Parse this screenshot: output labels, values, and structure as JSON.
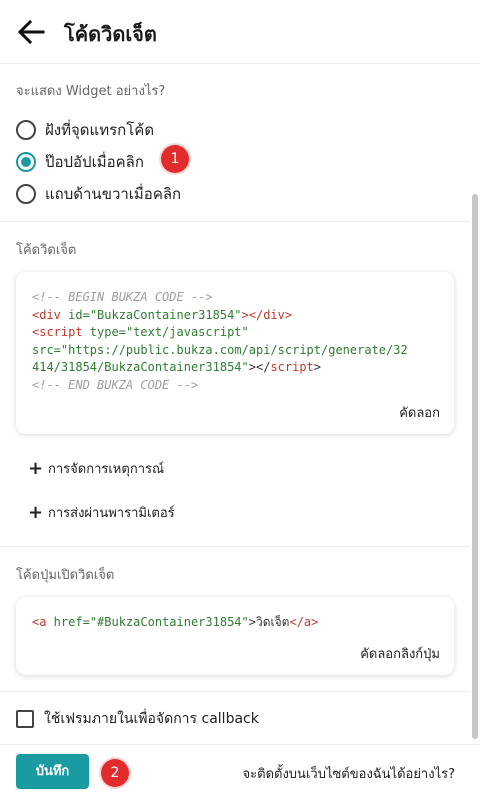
{
  "header": {
    "title": "โค้ดวิดเจ็ต",
    "back_icon": "arrow-left-icon"
  },
  "display_section": {
    "label": "จะแสดง Widget อย่างไร?",
    "options": [
      {
        "label": "ฝังที่จุดแทรกโค้ด",
        "checked": false
      },
      {
        "label": "ป๊อปอัปเมื่อคลิก",
        "checked": true
      },
      {
        "label": "แถบด้านขวาเมื่อคลิก",
        "checked": false
      }
    ]
  },
  "badges": {
    "first": "1",
    "second": "2"
  },
  "widget_code_section": {
    "label": "โค้ดวิดเจ็ต",
    "code": {
      "comment_begin": "<!-- BEGIN BUKZA CODE -->",
      "div_open": "<div",
      "div_id_attr": " id=",
      "div_id_value": "\"BukzaContainer31854\"",
      "div_close": "></div>",
      "script_open": "<script",
      "script_type_attr": " type=",
      "script_type_value": "\"text/javascript\"",
      "src_attr": "src=",
      "src_value_line1": "\"https://public.bukza.com/api/script/generate/32",
      "src_value_line2": "414/31854/BukzaContainer31854\"",
      "script_close_open": "></",
      "script_close_tag": "script",
      "script_close_end": ">",
      "comment_end": "<!-- END BUKZA CODE -->"
    },
    "copy_label": "คัดลอก"
  },
  "expanders": {
    "event_handling": "การจัดการเหตุการณ์",
    "parameter_passing": "การส่งผ่านพารามิเตอร์"
  },
  "button_code_section": {
    "label": "โค้ดปุ่มเปิดวิดเจ็ต",
    "code": {
      "a_open": "<a",
      "href_attr": " href=",
      "href_value": "\"#BukzaContainer31854\"",
      "gt": ">",
      "link_text": "วิดเจ็ต",
      "a_close": "</a>"
    },
    "copy_label": "คัดลอกลิงก์ปุ่ม"
  },
  "iframe_checkbox": {
    "label": "ใช้เฟรมภายในเพื่อจัดการ callback",
    "checked": false
  },
  "footer": {
    "save_label": "บันทึก",
    "help_link": "จะติดตั้งบนเว็บไซต์ของฉันได้อย่างไร?"
  },
  "colors": {
    "accent": "#1a9ba1",
    "badge": "#e22b2b"
  }
}
